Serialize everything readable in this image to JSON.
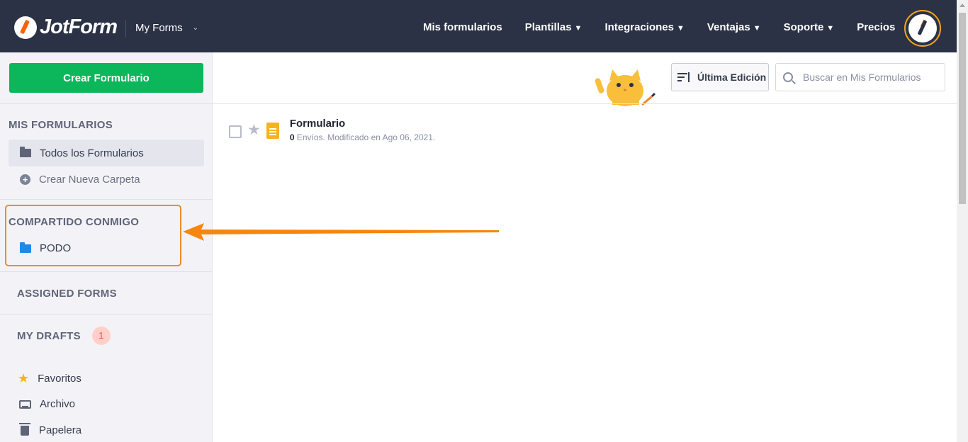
{
  "brand": {
    "name": "JotForm"
  },
  "header": {
    "context_menu": "My Forms",
    "nav": [
      {
        "label": "Mis formularios",
        "dropdown": false
      },
      {
        "label": "Plantillas",
        "dropdown": true
      },
      {
        "label": "Integraciones",
        "dropdown": true
      },
      {
        "label": "Ventajas",
        "dropdown": true
      },
      {
        "label": "Soporte",
        "dropdown": true
      },
      {
        "label": "Precios",
        "dropdown": false
      }
    ]
  },
  "sidebar": {
    "create_button": "Crear Formulario",
    "my_forms_title": "MIS FORMULARIOS",
    "all_forms": "Todos los Formularios",
    "new_folder": "Crear Nueva Carpeta",
    "shared_title": "COMPARTIDO CONMIGO",
    "shared_folder": "PODO",
    "assigned_title": "ASSIGNED FORMS",
    "drafts_title": "MY DRAFTS",
    "drafts_count": "1",
    "favorites": "Favoritos",
    "archive": "Archivo",
    "trash": "Papelera"
  },
  "toolbar": {
    "sort_label": "Última Edición",
    "search_placeholder": "Buscar en Mis Formularios"
  },
  "forms": [
    {
      "title": "Formulario",
      "submissions": "0",
      "meta_rest": " Envíos. Modificado en Ago 06, 2021."
    }
  ],
  "colors": {
    "topbar": "#2b3245",
    "create_button": "#0bb75a",
    "highlight": "#f08a24",
    "folder_shared": "#1d8ae8",
    "doc_icon": "#f7b31c"
  }
}
